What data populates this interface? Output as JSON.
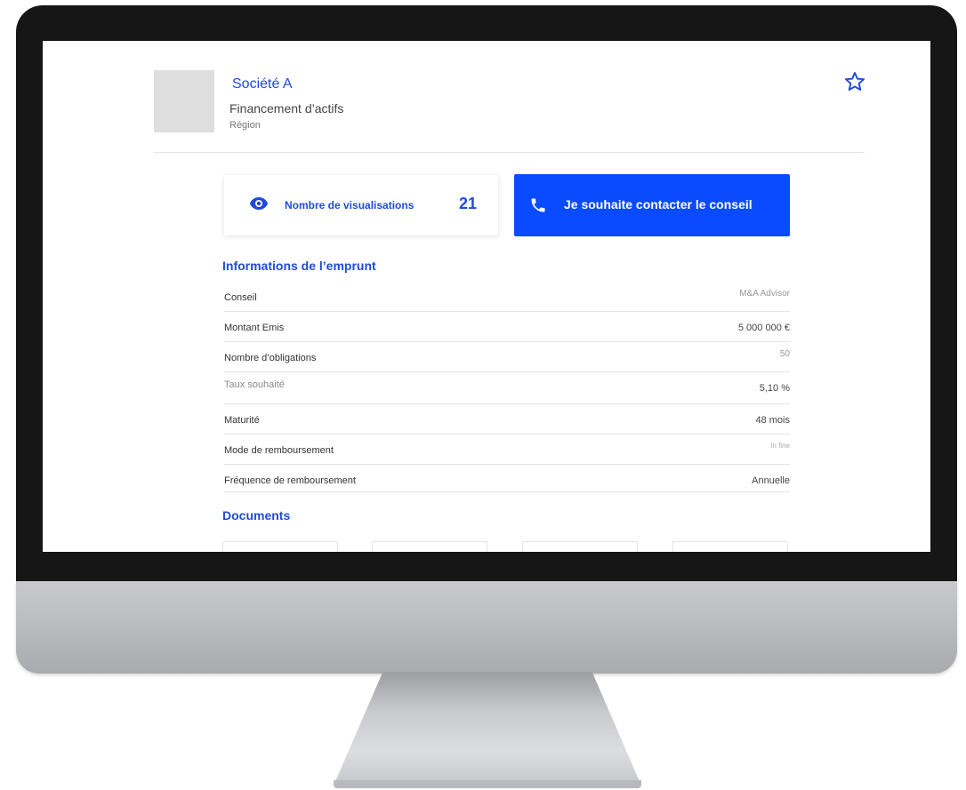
{
  "header": {
    "company_name": "Société A",
    "sector": "Financement d’actifs",
    "region": "Région",
    "favorite_icon": "star-outline-icon"
  },
  "views": {
    "label": "Nombre de visualisations",
    "count": "21",
    "icon": "eye-icon"
  },
  "contact": {
    "label": "Je souhaite contacter le conseil",
    "icon": "phone-icon"
  },
  "loan_info": {
    "title": "Informations de l’emprunt",
    "rows": [
      {
        "key": "Conseil",
        "value": "M&A Advisor"
      },
      {
        "key": "Montant Emis",
        "value": "5 000 000 €"
      },
      {
        "key": "Nombre d’obligations",
        "value": "50"
      },
      {
        "key": "Taux souhaité",
        "value": "5,10 %"
      },
      {
        "key": "Maturité",
        "value": "48 mois"
      },
      {
        "key": "Mode de remboursement",
        "value": "In fine"
      },
      {
        "key": "Fréquence de remboursement",
        "value": "Annuelle"
      }
    ]
  },
  "documents": {
    "title": "Documents"
  },
  "colors": {
    "accent": "#1f4bd8",
    "button": "#0a4bff",
    "bezel": "#161616"
  }
}
